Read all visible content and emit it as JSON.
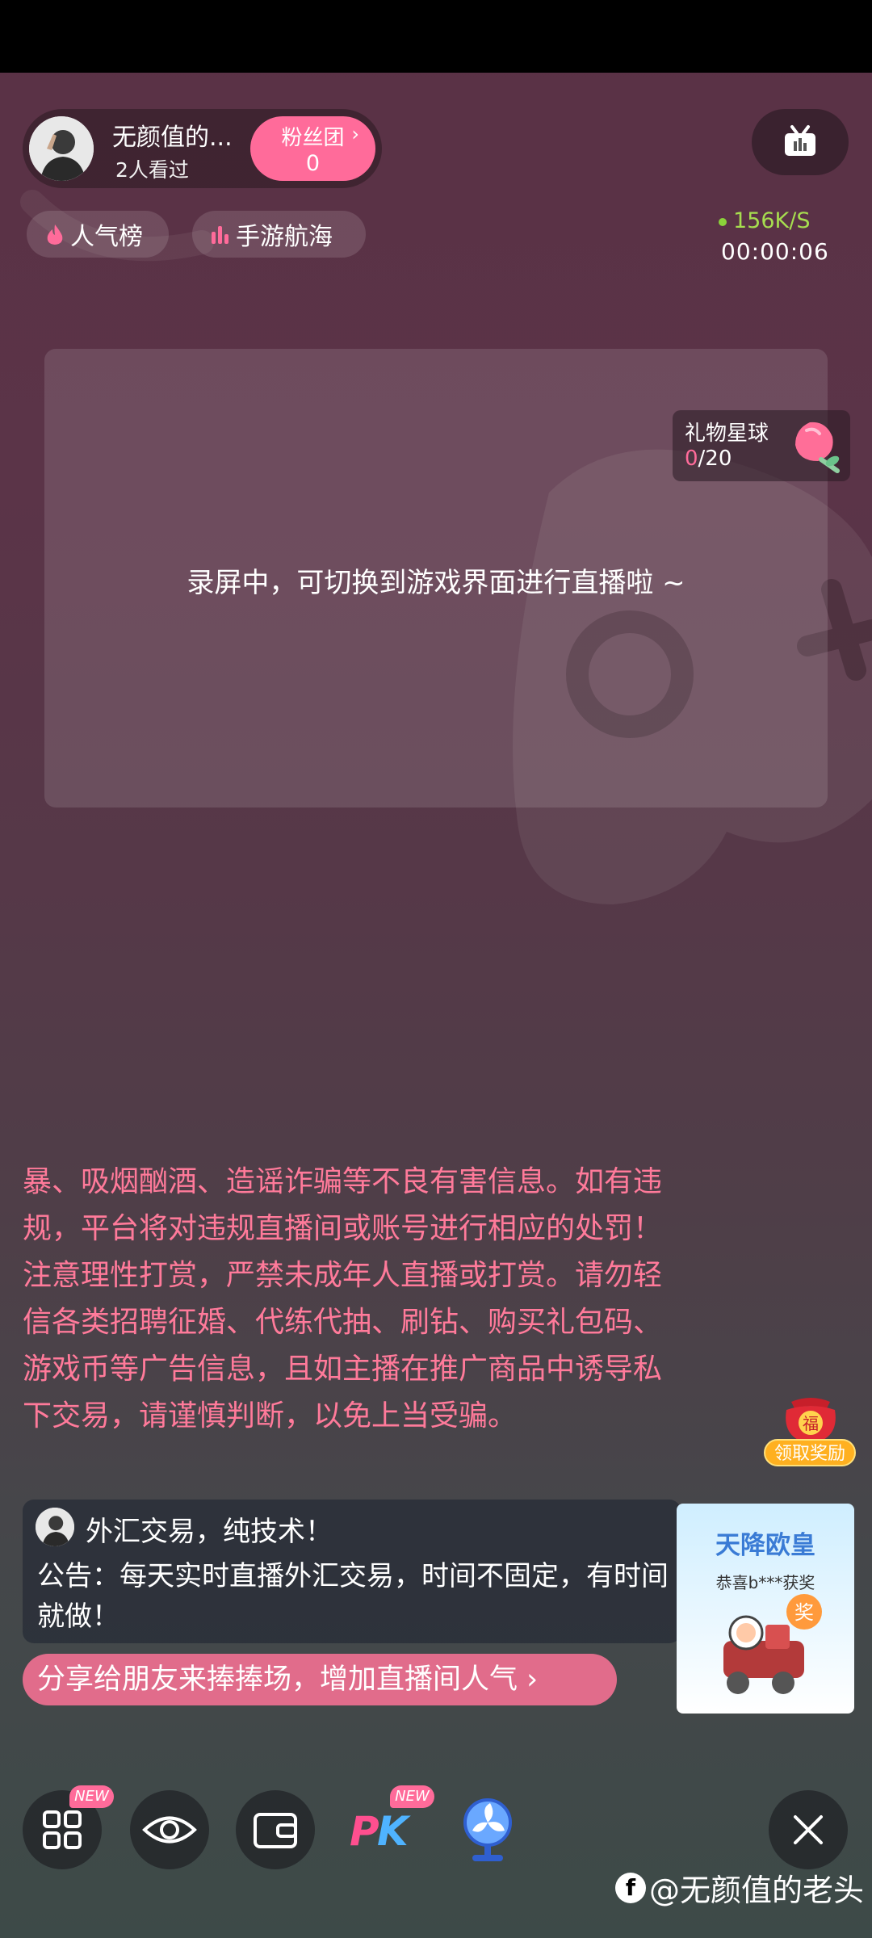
{
  "streamer": {
    "name": "无颜值的...",
    "views": "2人看过",
    "fan_button": {
      "label": "粉丝团",
      "count": "0"
    }
  },
  "tags": [
    {
      "label": "人气榜",
      "icon": "flame-icon"
    },
    {
      "label": "手游航海",
      "icon": "bars-icon"
    }
  ],
  "stats": {
    "net_speed": "156K/S",
    "timer": "00:00:06"
  },
  "gift_planet": {
    "title": "礼物星球",
    "current": "0",
    "total": "/20"
  },
  "recording_message": "录屏中，可切换到游戏界面进行直播啦 ~",
  "notice_text": "暴、吸烟酗酒、造谣诈骗等不良有害信息。如有违规，平台将对违规直播间或账号进行相应的处罚！注意理性打赏，严禁未成年人直播或打赏。请勿轻信各类招聘征婚、代练代抽、刷钻、购买礼包码、游戏币等广告信息，且如主播在推广商品中诱导私下交易，请谨慎判断，以免上当受骗。",
  "reward": {
    "badge_char": "福",
    "label": "领取奖励"
  },
  "chat": {
    "title": "外汇交易，纯技术！",
    "body": "公告：每天实时直播外汇交易，时间不固定，有时间就做！"
  },
  "share_button": "分享给朋友来捧捧场，增加直播间人气 ›",
  "promo": {
    "title": "天降欧皇",
    "subtitle": "恭喜b***获奖",
    "badge": "奖"
  },
  "toolbar": {
    "new_badge": "NEW",
    "pk_label": "PK"
  },
  "watermark": "@无颜值的老头",
  "colors": {
    "accent": "#ff6b9a",
    "speed": "#a6dd4f",
    "promo_title": "#3a7bd5"
  }
}
